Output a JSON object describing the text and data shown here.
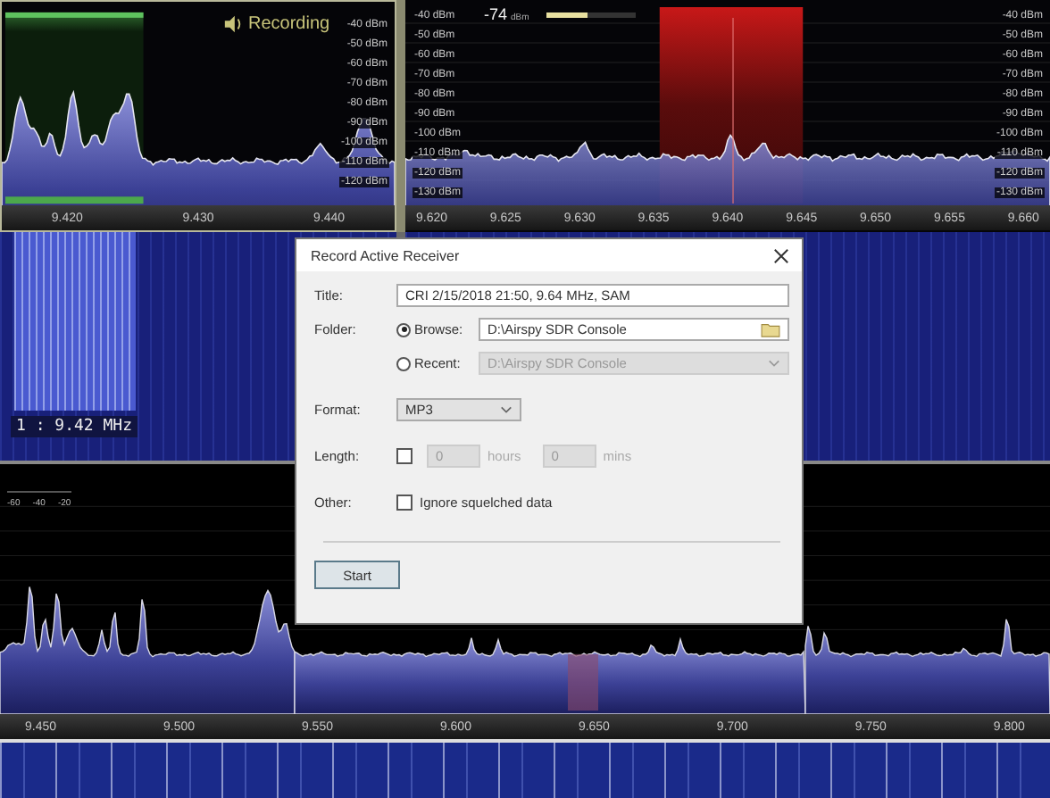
{
  "top_left_panel": {
    "status": "Recording",
    "level_labels": [
      "-40 dBm",
      "-50 dBm",
      "-60 dBm",
      "-70 dBm",
      "-80 dBm",
      "-90 dBm",
      "-100 dBm",
      "-110 dBm",
      "-120 dBm"
    ],
    "axis_labels": [
      "9.420",
      "9.430",
      "9.440"
    ]
  },
  "top_right_panel": {
    "signal_reading": "-74",
    "signal_unit": "dBm",
    "meter": {
      "level": 0.45
    },
    "level_labels_left": [
      "-40 dBm",
      "-50 dBm",
      "-60 dBm",
      "-70 dBm",
      "-80 dBm",
      "-90 dBm",
      "-100 dBm",
      "-110 dBm",
      "-120 dBm",
      "-130 dBm"
    ],
    "level_labels_right": [
      "-40 dBm",
      "-50 dBm",
      "-60 dBm",
      "-70 dBm",
      "-80 dBm",
      "-90 dBm",
      "-100 dBm",
      "-110 dBm",
      "-120 dBm",
      "-130 dBm"
    ],
    "axis_labels": [
      "9.620",
      "9.625",
      "9.630",
      "9.635",
      "9.640",
      "9.645",
      "9.650",
      "9.655",
      "9.660"
    ]
  },
  "waterfall_left": {
    "frequency_label": "1 : 9.42 MHz"
  },
  "bottom_panel": {
    "scale_labels": [
      "-60",
      "-40",
      "-20"
    ],
    "axis_labels": [
      "9.450",
      "9.500",
      "9.550",
      "9.600",
      "9.650",
      "9.700",
      "9.750",
      "9.800"
    ]
  },
  "dialog": {
    "title": "Record Active Receiver",
    "title_label": "Title:",
    "title_value": "CRI 2/15/2018 21:50, 9.64 MHz, SAM",
    "folder_label": "Folder:",
    "folder_options": [
      {
        "kind": "browse",
        "label": "Browse:",
        "selected": true,
        "path": "D:\\Airspy SDR Console",
        "disabled": false
      },
      {
        "kind": "recent",
        "label": "Recent:",
        "selected": false,
        "path": "D:\\Airspy SDR Console",
        "disabled": true
      }
    ],
    "format_label": "Format:",
    "format_value": "MP3",
    "length_label": "Length:",
    "length_checked": false,
    "length_disabled": true,
    "hours_value": "0",
    "hours_unit": "hours",
    "mins_value": "0",
    "mins_unit": "mins",
    "other_label": "Other:",
    "ignore_squelch": {
      "label": "Ignore squelched data",
      "checked": false
    },
    "start_button": "Start"
  }
}
